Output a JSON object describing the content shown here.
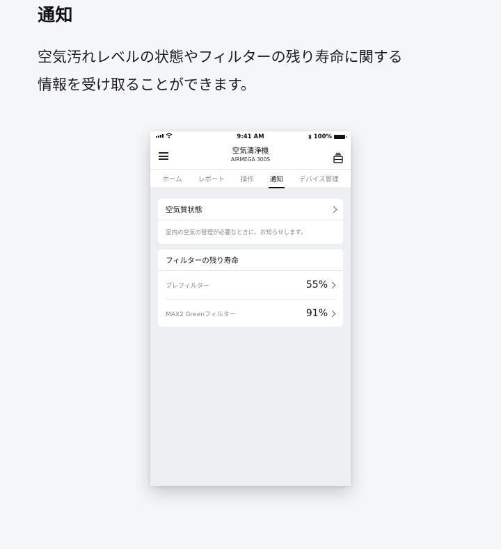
{
  "heading": "通知",
  "description_lines": [
    "空気汚れレベルの状態やフィルターの残り寿命に関する",
    "情報を受け取ることができます。"
  ],
  "phone": {
    "status": {
      "time": "9:41 AM",
      "battery": "100%"
    },
    "header": {
      "title": "空気清浄機",
      "subtitle": "AIRMEGA 300S",
      "menu_icon": "hamburger-menu-icon",
      "device_icon": "air-purifier-icon"
    },
    "tabs": [
      {
        "label": "ホーム"
      },
      {
        "label": "レポート"
      },
      {
        "label": "操作"
      },
      {
        "label": "通知"
      },
      {
        "label": "デバイス管理"
      }
    ],
    "active_tab": "通知",
    "air_quality": {
      "title": "空気質状態",
      "description": "室内の空気の管理が必要なときに、お知らせします。"
    },
    "filter_life": {
      "title": "フィルターの残り寿命",
      "items": [
        {
          "name": "プレフィルター",
          "percent": "55%"
        },
        {
          "name": "MAX2 Greenフィルター",
          "percent": "91%"
        }
      ]
    }
  }
}
